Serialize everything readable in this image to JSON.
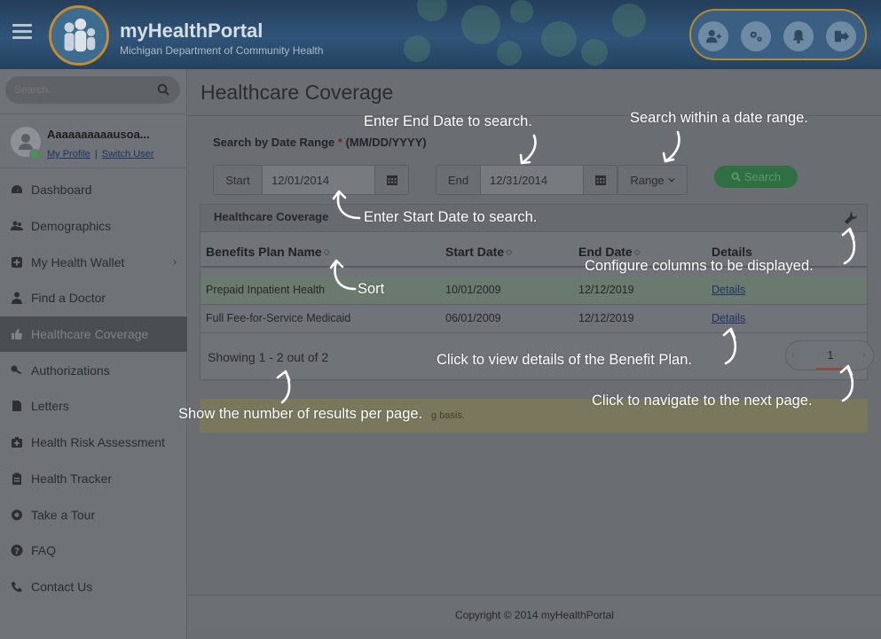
{
  "header": {
    "app_name": "myHealthPortal",
    "subtitle": "Michigan Department of Community Health",
    "icons": [
      "add-user-icon",
      "gear-icon",
      "bell-icon",
      "logout-icon"
    ]
  },
  "sidebar": {
    "search_placeholder": "Search...",
    "user_name": "Aaaaaaaaaausoa...",
    "my_profile": "My Profile",
    "separator": "|",
    "switch_user": "Switch User",
    "items": [
      {
        "label": "Dashboard",
        "icon": "dashboard-icon"
      },
      {
        "label": "Demographics",
        "icon": "users-icon"
      },
      {
        "label": "My Health Wallet",
        "icon": "plus-square-icon",
        "chevron": "›"
      },
      {
        "label": "Find a Doctor",
        "icon": "doctor-icon"
      },
      {
        "label": "Healthcare Coverage",
        "icon": "thumbs-up-icon",
        "active": true
      },
      {
        "label": "Authorizations",
        "icon": "key-icon"
      },
      {
        "label": "Letters",
        "icon": "file-icon"
      },
      {
        "label": "Health Risk Assessment",
        "icon": "medkit-icon"
      },
      {
        "label": "Health Tracker",
        "icon": "clipboard-icon"
      },
      {
        "label": "Take a Tour",
        "icon": "compass-icon"
      },
      {
        "label": "FAQ",
        "icon": "question-icon"
      },
      {
        "label": "Contact Us",
        "icon": "phone-icon"
      }
    ]
  },
  "main": {
    "page_title": "Healthcare Coverage",
    "range_label": "Search by Date Range",
    "required_mark": "*",
    "date_format": "(MM/DD/YYYY)",
    "start_label": "Start",
    "start_value": "12/01/2014",
    "end_label": "End",
    "end_value": "12/31/2014",
    "range_button": "Range",
    "search_button": "Search",
    "panel_title": "Healthcare Coverage",
    "columns": [
      "Benefits Plan Name",
      "Start Date",
      "End Date",
      "Details"
    ],
    "rows": [
      {
        "plan": "Prepaid Inpatient Health",
        "start": "10/01/2009",
        "end": "12/12/2019",
        "details": "Details"
      },
      {
        "plan": "Full Fee-for-Service Medicaid",
        "start": "06/01/2009",
        "end": "12/12/2019",
        "details": "Details"
      }
    ],
    "showing": "Showing 1 - 2 out of 2",
    "page": "1",
    "prev_symbol": "‹",
    "next_symbol": "›",
    "note_fragment": "g basis.",
    "footer": "Copyright © 2014 myHealthPortal"
  },
  "annotations": {
    "end_date": "Enter End Date to search.",
    "date_range": "Search within a date range.",
    "start_date": "Enter Start Date to search.",
    "configure": "Configure columns to be displayed.",
    "sort": "Sort",
    "details": "Click to view details of the Benefit Plan.",
    "results": "Show the number of results per page.",
    "next_page": "Click to navigate to the next page."
  },
  "colors": {
    "header_bg": "#2f5478",
    "brand_ring": "#c88a2a",
    "search_green": "#2f6f43",
    "annotation_text": "#ffffff"
  }
}
